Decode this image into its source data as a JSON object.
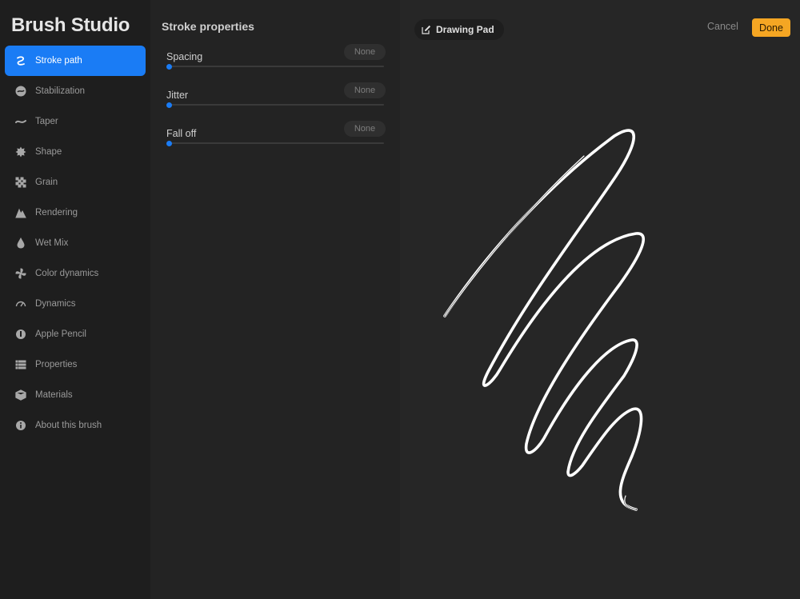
{
  "app": {
    "title": "Brush Studio"
  },
  "sidebar": {
    "items": [
      {
        "label": "Stroke path",
        "icon": "stroke-path-icon",
        "active": true
      },
      {
        "label": "Stabilization",
        "icon": "stabilization-icon"
      },
      {
        "label": "Taper",
        "icon": "taper-icon"
      },
      {
        "label": "Shape",
        "icon": "shape-icon"
      },
      {
        "label": "Grain",
        "icon": "grain-icon"
      },
      {
        "label": "Rendering",
        "icon": "rendering-icon"
      },
      {
        "label": "Wet Mix",
        "icon": "wet-mix-icon"
      },
      {
        "label": "Color dynamics",
        "icon": "color-dynamics-icon"
      },
      {
        "label": "Dynamics",
        "icon": "dynamics-icon"
      },
      {
        "label": "Apple Pencil",
        "icon": "apple-pencil-icon"
      },
      {
        "label": "Properties",
        "icon": "properties-icon"
      },
      {
        "label": "Materials",
        "icon": "materials-icon"
      },
      {
        "label": "About this brush",
        "icon": "about-icon"
      }
    ]
  },
  "panel": {
    "title": "Stroke properties",
    "properties": [
      {
        "label": "Spacing",
        "value": "None",
        "level": 0
      },
      {
        "label": "Jitter",
        "value": "None",
        "level": 0
      },
      {
        "label": "Fall off",
        "value": "None",
        "level": 0
      }
    ]
  },
  "pad": {
    "title": "Drawing Pad",
    "cancel_label": "Cancel",
    "done_label": "Done"
  },
  "colors": {
    "accent": "#1a7cf5",
    "done": "#f5a623",
    "sidebar_bg": "#1e1e1e",
    "panel_bg": "#232323",
    "pad_bg": "#262626"
  }
}
